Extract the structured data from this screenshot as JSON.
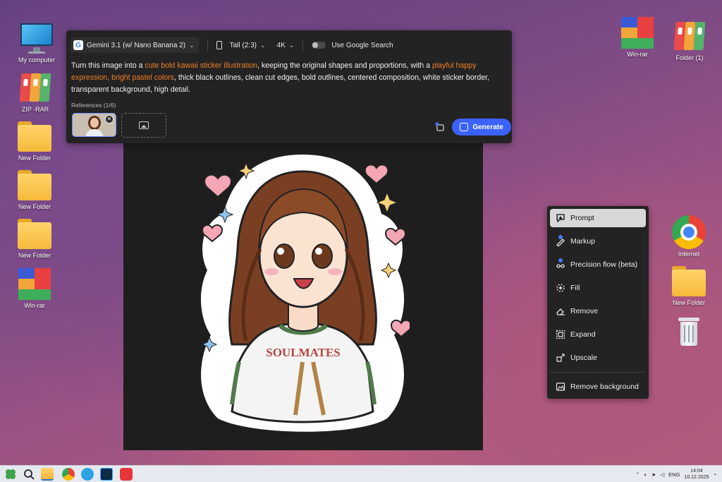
{
  "desktop": {
    "left_icons": [
      {
        "label": "My computer",
        "icon": "monitor-icon"
      },
      {
        "label": "ZIP -RAR",
        "icon": "binder-icon"
      },
      {
        "label": "New Folder",
        "icon": "folder-icon"
      },
      {
        "label": "New Folder",
        "icon": "folder-icon"
      },
      {
        "label": "New Folder",
        "icon": "folder-icon"
      },
      {
        "label": "Win-rar",
        "icon": "winrar-icon"
      }
    ],
    "right_icons": [
      {
        "label": "Win-rar",
        "icon": "winrar-icon"
      },
      {
        "label": "Folder (1)",
        "icon": "binder-icon"
      },
      {
        "label": "Internet",
        "icon": "chrome-icon"
      },
      {
        "label": "New Folder",
        "icon": "folder-icon"
      },
      {
        "label": "",
        "icon": "trash-icon"
      }
    ]
  },
  "prompt_panel": {
    "model_label": "Gemini 3.1 (w/ Nano Banana 2)",
    "aspect_label": "Tall (2:3)",
    "resolution_label": "4K",
    "google_search_label": "Use Google Search",
    "google_search_enabled": false,
    "prompt_segments": [
      {
        "text": "Turn this image into a ",
        "highlight": false
      },
      {
        "text": "cute bold kawaii sticker illustration",
        "highlight": true
      },
      {
        "text": ", keeping the original shapes and proportions, with a ",
        "highlight": false
      },
      {
        "text": "playful happy expression, bright pastel colors",
        "highlight": true
      },
      {
        "text": ", thick black outlines, clean cut edges, bold outlines, centered composition, white sticker border, transparent background, high detail.",
        "highlight": false
      }
    ],
    "references_label": "References (1/6)",
    "generate_label": "Generate"
  },
  "canvas": {
    "shirt_text": "SOULMATES"
  },
  "tool_menu": {
    "items": [
      {
        "label": "Prompt",
        "icon": "prompt-icon",
        "active": true,
        "dot": false
      },
      {
        "label": "Markup",
        "icon": "markup-icon",
        "active": false,
        "dot": true
      },
      {
        "label": "Precision flow (beta)",
        "icon": "precision-flow-icon",
        "active": false,
        "dot": true
      },
      {
        "label": "Fill",
        "icon": "fill-icon",
        "active": false,
        "dot": false
      },
      {
        "label": "Remove",
        "icon": "remove-icon",
        "active": false,
        "dot": false
      },
      {
        "label": "Expand",
        "icon": "expand-icon",
        "active": false,
        "dot": false
      },
      {
        "label": "Upscale",
        "icon": "upscale-icon",
        "active": false,
        "dot": false
      },
      {
        "label": "Remove background",
        "icon": "remove-background-icon",
        "active": false,
        "dot": false
      }
    ]
  },
  "taskbar": {
    "language": "ENG",
    "time": "14:04",
    "date": "10.12.2025"
  },
  "colors": {
    "accent_blue": "#3b63fb",
    "highlight_orange": "#f07f24",
    "panel_bg": "#232323"
  }
}
